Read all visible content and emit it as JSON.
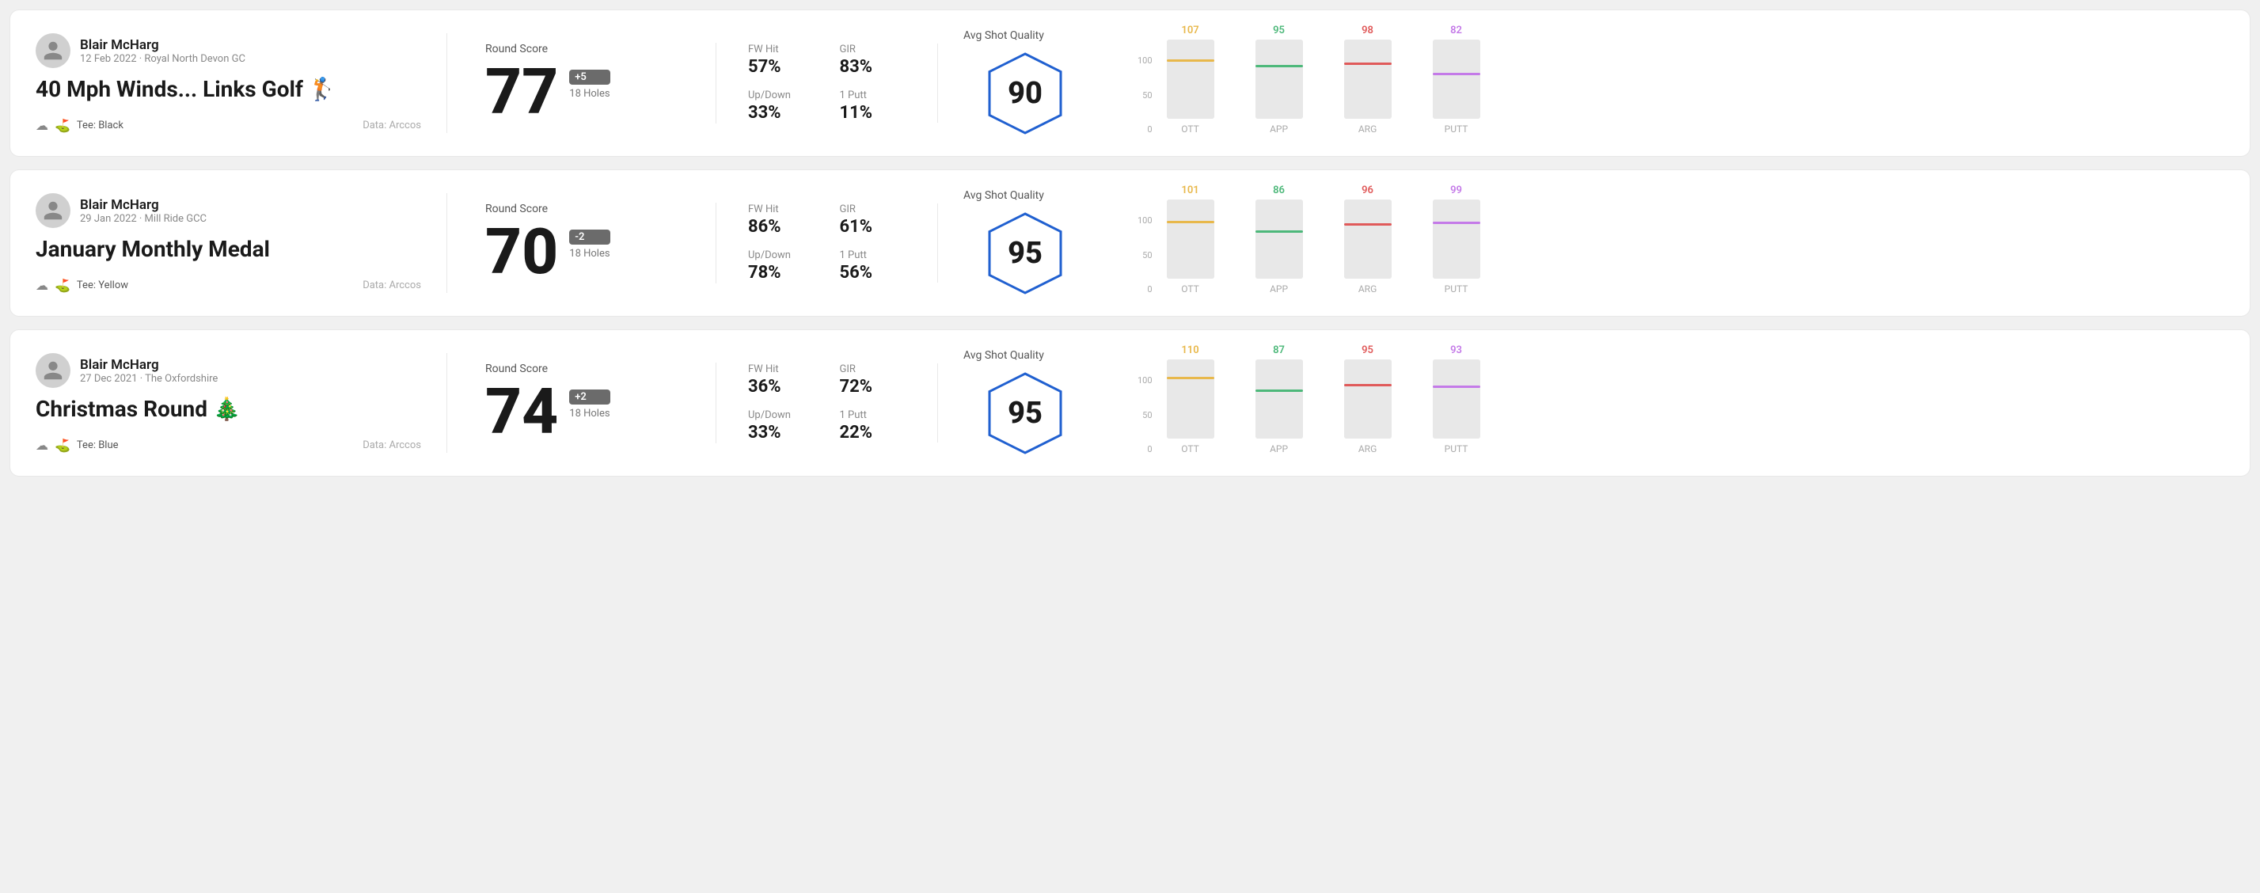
{
  "rounds": [
    {
      "id": "round-1",
      "user": {
        "name": "Blair McHarg",
        "meta": "12 Feb 2022 · Royal North Devon GC"
      },
      "title": "40 Mph Winds... Links Golf 🏌️",
      "tee": "Black",
      "data_source": "Data: Arccos",
      "round_score_label": "Round Score",
      "score": "77",
      "score_badge": "+5",
      "score_badge_type": "positive",
      "holes": "18 Holes",
      "stats": {
        "fw_hit_label": "FW Hit",
        "fw_hit_value": "57%",
        "gir_label": "GIR",
        "gir_value": "83%",
        "updown_label": "Up/Down",
        "updown_value": "33%",
        "oneputt_label": "1 Putt",
        "oneputt_value": "11%"
      },
      "avg_shot_quality_label": "Avg Shot Quality",
      "quality_score": "90",
      "chart": {
        "columns": [
          {
            "label": "OTT",
            "value": 107,
            "color": "#e8b84b",
            "bar_pct": 72
          },
          {
            "label": "APP",
            "value": 95,
            "color": "#4db87a",
            "bar_pct": 65
          },
          {
            "label": "ARG",
            "value": 98,
            "color": "#e05a5a",
            "bar_pct": 68
          },
          {
            "label": "PUTT",
            "value": 82,
            "color": "#c47ae8",
            "bar_pct": 55
          }
        ]
      }
    },
    {
      "id": "round-2",
      "user": {
        "name": "Blair McHarg",
        "meta": "29 Jan 2022 · Mill Ride GCC"
      },
      "title": "January Monthly Medal",
      "tee": "Yellow",
      "data_source": "Data: Arccos",
      "round_score_label": "Round Score",
      "score": "70",
      "score_badge": "-2",
      "score_badge_type": "negative",
      "holes": "18 Holes",
      "stats": {
        "fw_hit_label": "FW Hit",
        "fw_hit_value": "86%",
        "gir_label": "GIR",
        "gir_value": "61%",
        "updown_label": "Up/Down",
        "updown_value": "78%",
        "oneputt_label": "1 Putt",
        "oneputt_value": "56%"
      },
      "avg_shot_quality_label": "Avg Shot Quality",
      "quality_score": "95",
      "chart": {
        "columns": [
          {
            "label": "OTT",
            "value": 101,
            "color": "#e8b84b",
            "bar_pct": 70
          },
          {
            "label": "APP",
            "value": 86,
            "color": "#4db87a",
            "bar_pct": 58
          },
          {
            "label": "ARG",
            "value": 96,
            "color": "#e05a5a",
            "bar_pct": 67
          },
          {
            "label": "PUTT",
            "value": 99,
            "color": "#c47ae8",
            "bar_pct": 69
          }
        ]
      }
    },
    {
      "id": "round-3",
      "user": {
        "name": "Blair McHarg",
        "meta": "27 Dec 2021 · The Oxfordshire"
      },
      "title": "Christmas Round 🎄",
      "tee": "Blue",
      "data_source": "Data: Arccos",
      "round_score_label": "Round Score",
      "score": "74",
      "score_badge": "+2",
      "score_badge_type": "positive",
      "holes": "18 Holes",
      "stats": {
        "fw_hit_label": "FW Hit",
        "fw_hit_value": "36%",
        "gir_label": "GIR",
        "gir_value": "72%",
        "updown_label": "Up/Down",
        "updown_value": "33%",
        "oneputt_label": "1 Putt",
        "oneputt_value": "22%"
      },
      "avg_shot_quality_label": "Avg Shot Quality",
      "quality_score": "95",
      "chart": {
        "columns": [
          {
            "label": "OTT",
            "value": 110,
            "color": "#e8b84b",
            "bar_pct": 75
          },
          {
            "label": "APP",
            "value": 87,
            "color": "#4db87a",
            "bar_pct": 59
          },
          {
            "label": "ARG",
            "value": 95,
            "color": "#e05a5a",
            "bar_pct": 66
          },
          {
            "label": "PUTT",
            "value": 93,
            "color": "#c47ae8",
            "bar_pct": 64
          }
        ]
      }
    }
  ],
  "y_axis_labels": [
    "100",
    "50",
    "0"
  ]
}
